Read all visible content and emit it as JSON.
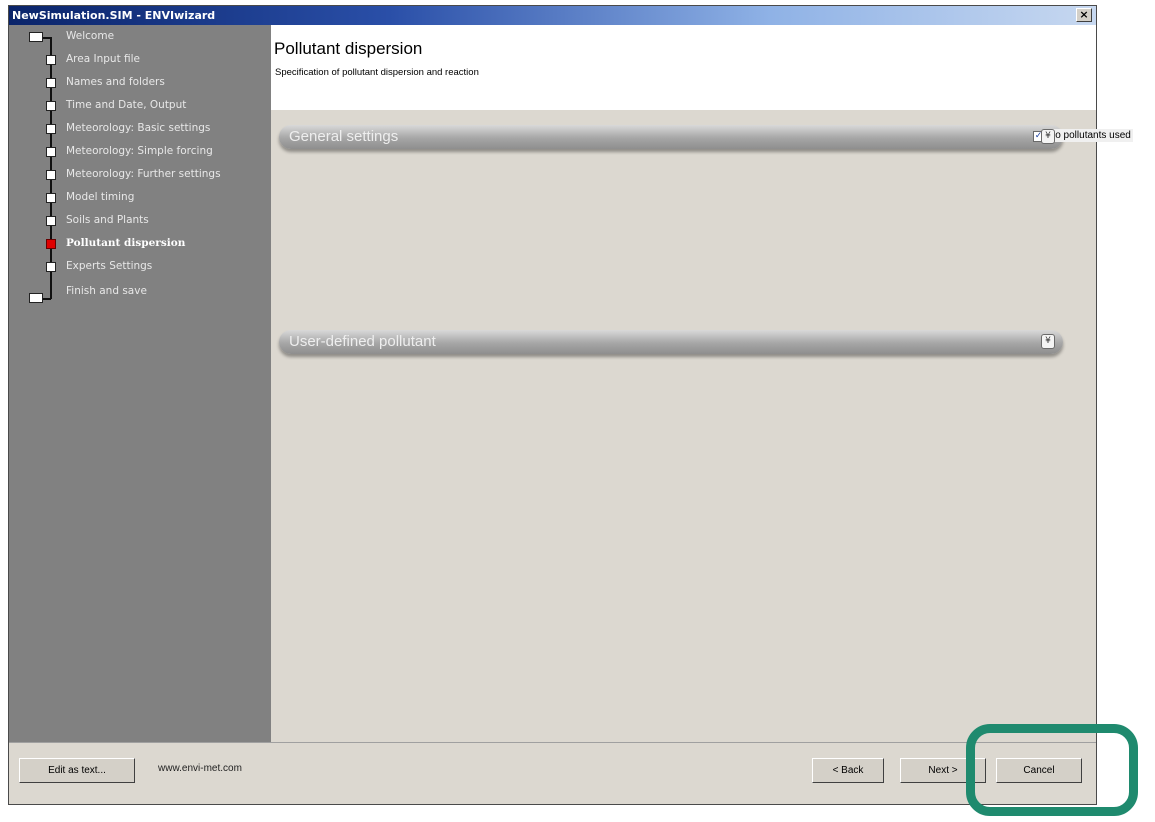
{
  "window": {
    "title": "NewSimulation.SIM - ENVIwizard",
    "close_symbol": "×"
  },
  "sidebar": {
    "items": [
      {
        "label": "Welcome",
        "state": "done"
      },
      {
        "label": "Area Input file",
        "state": "done"
      },
      {
        "label": "Names and folders",
        "state": "done"
      },
      {
        "label": "Time and Date, Output",
        "state": "done"
      },
      {
        "label": "Meteorology: Basic settings",
        "state": "done"
      },
      {
        "label": "Meteorology: Simple forcing",
        "state": "done"
      },
      {
        "label": "Meteorology: Further settings",
        "state": "done"
      },
      {
        "label": "Model timing",
        "state": "done"
      },
      {
        "label": "Soils and Plants",
        "state": "done"
      },
      {
        "label": "Pollutant dispersion",
        "state": "active"
      },
      {
        "label": "Experts Settings",
        "state": "pending"
      },
      {
        "label": "Finish and save",
        "state": "pending"
      }
    ]
  },
  "header": {
    "title": "Pollutant dispersion",
    "subtitle": "Specification of pollutant dispersion and reaction"
  },
  "groups": {
    "general": {
      "title": "General settings",
      "checkbox_label": "No pollutants used",
      "checkbox_checked": true,
      "check_symbol": "✓",
      "collapse_symbol": "¥"
    },
    "user_defined": {
      "title": "User-defined pollutant",
      "collapse_symbol": "¥"
    }
  },
  "footer": {
    "edit_as_text": "Edit as text...",
    "website": "www.envi-met.com",
    "back": "< Back",
    "next": "Next >",
    "cancel": "Cancel"
  },
  "colors": {
    "sidebar_bg": "#818181",
    "active_node": "#e00000",
    "highlight_ring": "#1f8a6e",
    "titlebar_start": "#0a246a"
  }
}
